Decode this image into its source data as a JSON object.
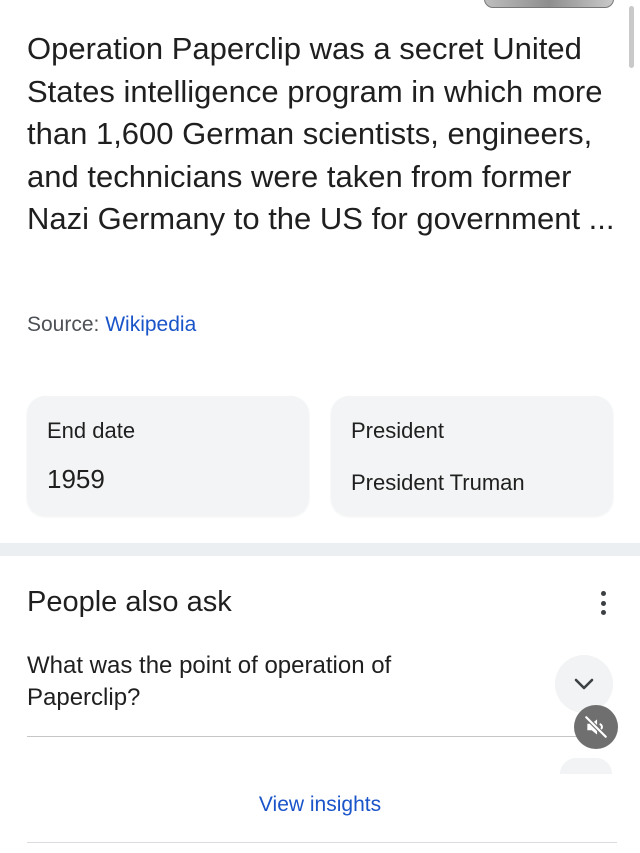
{
  "summary": {
    "text": "Operation Paperclip was a secret United States intelligence program in which more than 1,600 German scientists, engineers, and technicians were taken from former Nazi Germany to the US for government ...",
    "source_prefix": "Source: ",
    "source_link": "Wikipedia"
  },
  "facts": [
    {
      "label": "End date",
      "value": "1959"
    },
    {
      "label": "President",
      "value": "President Truman"
    }
  ],
  "people_also_ask": {
    "title": "People also ask",
    "questions": [
      {
        "text": "What was the point of operation of Paperclip?"
      }
    ],
    "view_insights": "View insights"
  },
  "icons": {
    "more": "more-vert-icon",
    "expand": "chevron-down-icon",
    "mute": "volume-off-icon"
  },
  "colors": {
    "link": "#1a54c9",
    "card_bg": "#f3f4f5",
    "text": "#1f1f1f"
  }
}
